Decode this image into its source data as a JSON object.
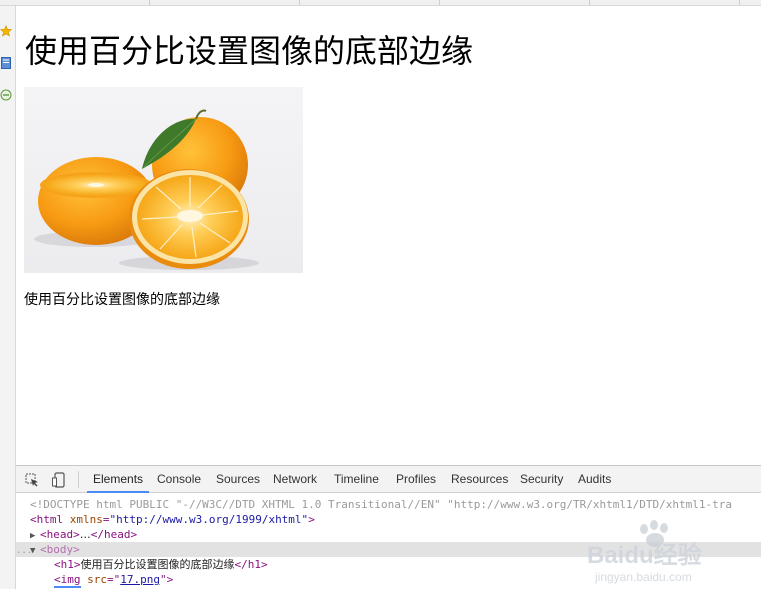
{
  "page": {
    "heading": "使用百分比设置图像的底部边缘",
    "caption": "使用百分比设置图像的底部边缘"
  },
  "devtools": {
    "tabs": [
      {
        "label": "Elements",
        "active": true
      },
      {
        "label": "Console"
      },
      {
        "label": "Sources"
      },
      {
        "label": "Network"
      },
      {
        "label": "Timeline"
      },
      {
        "label": "Profiles"
      },
      {
        "label": "Resources"
      },
      {
        "label": "Security"
      },
      {
        "label": "Audits"
      }
    ],
    "tools": [
      "inspect-element-icon",
      "device-mode-icon"
    ],
    "tree": {
      "doctype": "<!DOCTYPE html PUBLIC \"-//W3C//DTD XHTML 1.0 Transitional//EN\" \"http://www.w3.org/TR/xhtml1/DTD/xhtml1-tra",
      "html_open": "<html",
      "html_attr": "xmlns",
      "html_val": "\"http://www.w3.org/1999/xhtml\"",
      "html_close": ">",
      "head": "<head>",
      "head_ellipsis": "…",
      "head_close": "</head>",
      "body": "<body>",
      "h1_open": "<h1>",
      "h1_text": "使用百分比设置图像的底部边缘",
      "h1_close": "</h1>",
      "img_open": "<img",
      "img_attr": "src",
      "img_val": "17.png",
      "img_close": ">",
      "ellipsis_marker": "..."
    }
  },
  "watermark": {
    "brand": "Baidu经验",
    "url": "jingyan.baidu.com"
  },
  "colors": {
    "active_tab": "#4c8bf5",
    "tag": "#881280",
    "attr": "#994500",
    "value": "#1a1aa6",
    "star": "#f3b400"
  }
}
